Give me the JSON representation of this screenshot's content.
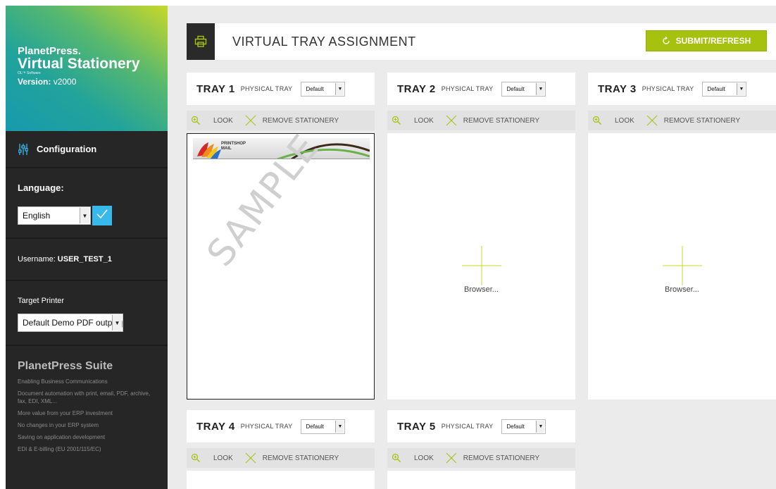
{
  "brand": {
    "line1": "PlanetPress.",
    "line2": "Virtual Stationery",
    "small": "OL™ Software",
    "version_label": "Version:",
    "version_value": "v2000",
    "gradient_colors": [
      "#179aae",
      "#57b86f",
      "#c9d82a"
    ]
  },
  "sidebar": {
    "config_label": "Configuration",
    "language_label": "Language:",
    "language_value": "English",
    "username_label": "Username:",
    "username_value": "USER_TEST_1",
    "printer_label": "Target Printer",
    "printer_value": "Default Demo PDF output p",
    "suite_title": "PlanetPress Suite",
    "suite_items": [
      "Enabling Business Communications",
      "Document automation with print, email, PDF, archive, fax, EDI, XML...",
      "More value from your ERP investment",
      "No changes in your ERP system",
      "Saving on application development",
      "EDI & E-billing (EU 2001/115/EC)"
    ],
    "accent_color": "#37b9ea"
  },
  "header": {
    "title": "VIRTUAL TRAY ASSIGNMENT",
    "submit_label": "SUBMIT/REFRESH",
    "submit_color": "#a6c10e"
  },
  "trays": [
    {
      "title": "TRAY 1",
      "sub": "PHYSICAL TRAY",
      "select": "Default",
      "look": "LOOK",
      "remove": "REMOVE STATIONERY",
      "preview": "SAMPLE",
      "stationery_logo": "PRINTSHOP MAIL"
    },
    {
      "title": "TRAY 2",
      "sub": "PHYSICAL TRAY",
      "select": "Default",
      "look": "LOOK",
      "remove": "REMOVE STATIONERY",
      "browse": "Browser..."
    },
    {
      "title": "TRAY 3",
      "sub": "PHYSICAL TRAY",
      "select": "Default",
      "look": "LOOK",
      "remove": "REMOVE STATIONERY",
      "browse": "Browser..."
    },
    {
      "title": "TRAY 4",
      "sub": "PHYSICAL TRAY",
      "select": "Default",
      "look": "LOOK",
      "remove": "REMOVE STATIONERY"
    },
    {
      "title": "TRAY 5",
      "sub": "PHYSICAL TRAY",
      "select": "Default",
      "look": "LOOK",
      "remove": "REMOVE STATIONERY"
    }
  ]
}
